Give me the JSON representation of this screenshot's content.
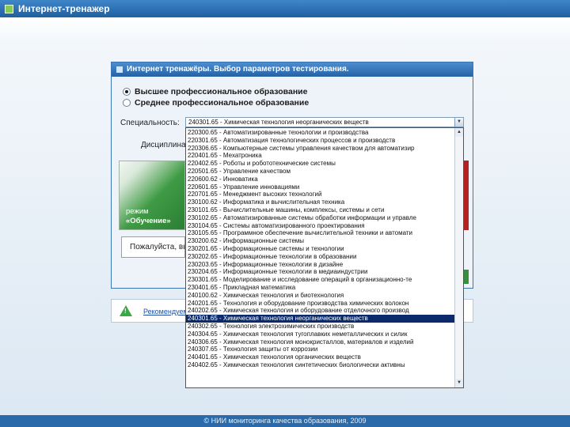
{
  "app": {
    "title": "Интернет-тренажер"
  },
  "dialog": {
    "title": "Интернет тренажёры. Выбор параметров тестирования.",
    "radios": [
      {
        "label": "Высшее профессиональное образование",
        "checked": true
      },
      {
        "label": "Среднее профессиональное образование",
        "checked": false
      }
    ],
    "specialty_label": "Специальность:",
    "discipline_label": "Дисциплина:",
    "selected_specialty": "240301.65 - Химическая технология неорганических веществ",
    "mode_panel": {
      "line1": "режим",
      "line2": "«Обучение»"
    },
    "status_text": "Пожалуйста, вы"
  },
  "dropdown": {
    "selected_index": 24,
    "items": [
      "220300.65 - Автоматизированные технологии и производства",
      "220301.65 - Автоматизация технологических процессов и производств",
      "220306.65 - Компьютерные системы управления качеством для автоматизир",
      "220401.65 - Мехатроника",
      "220402.65 - Роботы и робототехнические системы",
      "220501.65 - Управление качеством",
      "220600.62 - Инноватика",
      "220601.65 - Управление инновациями",
      "220701.65 - Менеджмент высоких технологий",
      "230100.62 - Информатика и вычислительная техника",
      "230101.65 - Вычислительные машины, комплексы, системы и сети",
      "230102.65 - Автоматизированные системы обработки информации и управле",
      "230104.65 - Системы автоматизированного проектирования",
      "230105.65 - Программное обеспечение вычислительной техники и автомати",
      "230200.62 - Информационные системы",
      "230201.65 - Информационные системы и технологии",
      "230202.65 - Информационные технологии в образовании",
      "230203.65 - Информационные технологии в дизайне",
      "230204.65 - Информационные технологии в медиаиндустрии",
      "230301.65 - Моделирование и исследование операций в организационно-те",
      "230401.65 - Прикладная математика",
      "240100.62 - Химическая технология и биотехнология",
      "240201.65 - Технология и оборудование производства химических волокон",
      "240202.65 - Химическая технология и оборудование отделочного производ",
      "240301.65 - Химическая технология неорганических веществ",
      "240302.65 - Технология электрохимических производств",
      "240304.65 - Химическая технология тугоплавких неметаллических и силик",
      "240306.65 - Химическая технология монокристаллов, материалов и изделий",
      "240307.65 - Технология защиты от коррозии",
      "240401.65 - Химическая технология органических веществ",
      "240402.65 - Химическая технология синтетических биологически активны"
    ]
  },
  "notice": {
    "text": "Рекомендуемые параметры для отображения"
  },
  "footer": {
    "text": "© НИИ мониторинга качества образования, 2009"
  },
  "colors": {
    "accent": "#2a6aaa",
    "selection": "#0a2a6b",
    "mode_green": "#3f9b45"
  }
}
